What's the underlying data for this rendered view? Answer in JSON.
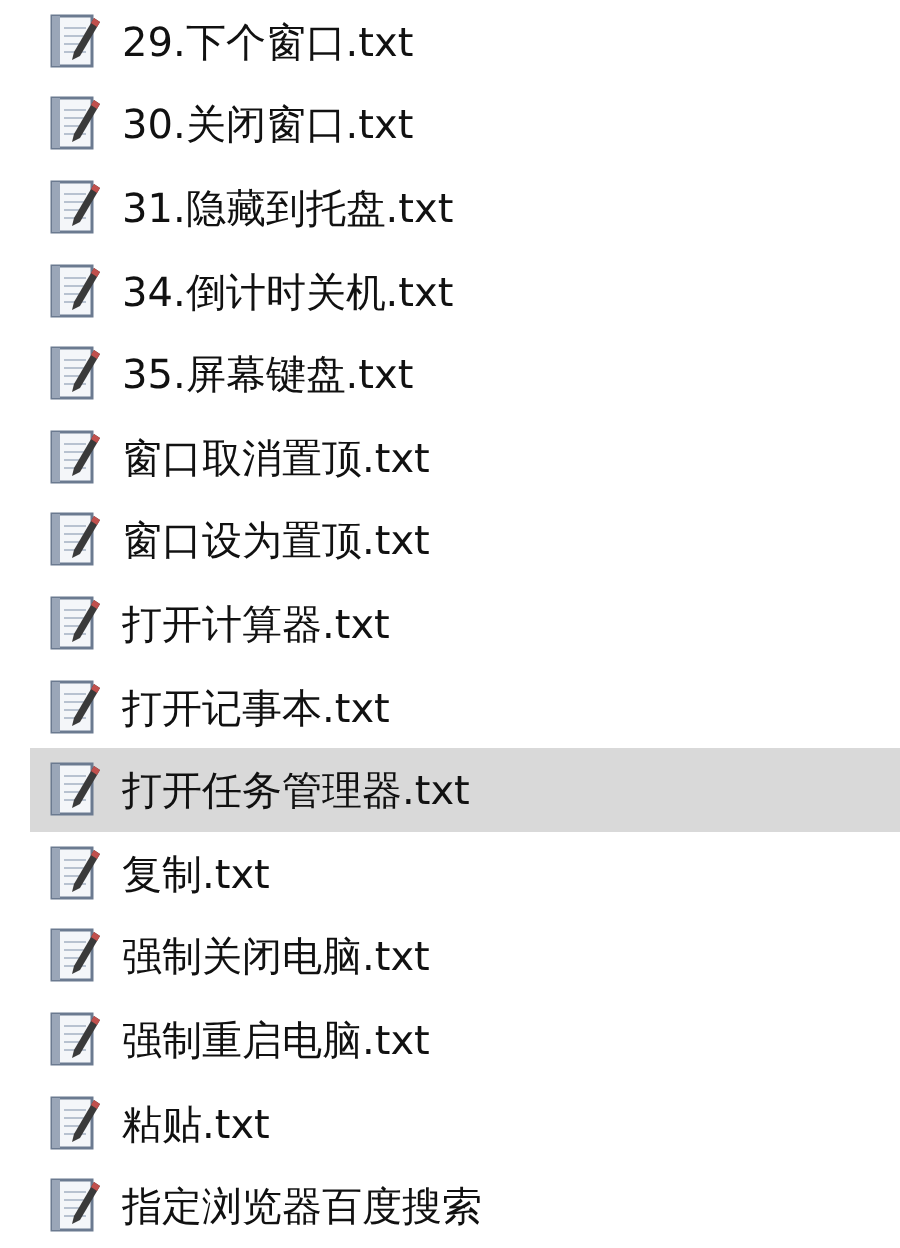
{
  "files": [
    {
      "name": "29.下个窗口.txt",
      "selected": false
    },
    {
      "name": "30.关闭窗口.txt",
      "selected": false
    },
    {
      "name": "31.隐藏到托盘.txt",
      "selected": false
    },
    {
      "name": "34.倒计时关机.txt",
      "selected": false
    },
    {
      "name": "35.屏幕键盘.txt",
      "selected": false
    },
    {
      "name": "窗口取消置顶.txt",
      "selected": false
    },
    {
      "name": "窗口设为置顶.txt",
      "selected": false
    },
    {
      "name": "打开计算器.txt",
      "selected": false
    },
    {
      "name": "打开记事本.txt",
      "selected": false
    },
    {
      "name": "打开任务管理器.txt",
      "selected": true
    },
    {
      "name": "复制.txt",
      "selected": false
    },
    {
      "name": "强制关闭电脑.txt",
      "selected": false
    },
    {
      "name": "强制重启电脑.txt",
      "selected": false
    },
    {
      "name": "粘贴.txt",
      "selected": false
    },
    {
      "name": "指定浏览器百度搜索",
      "selected": false
    }
  ]
}
